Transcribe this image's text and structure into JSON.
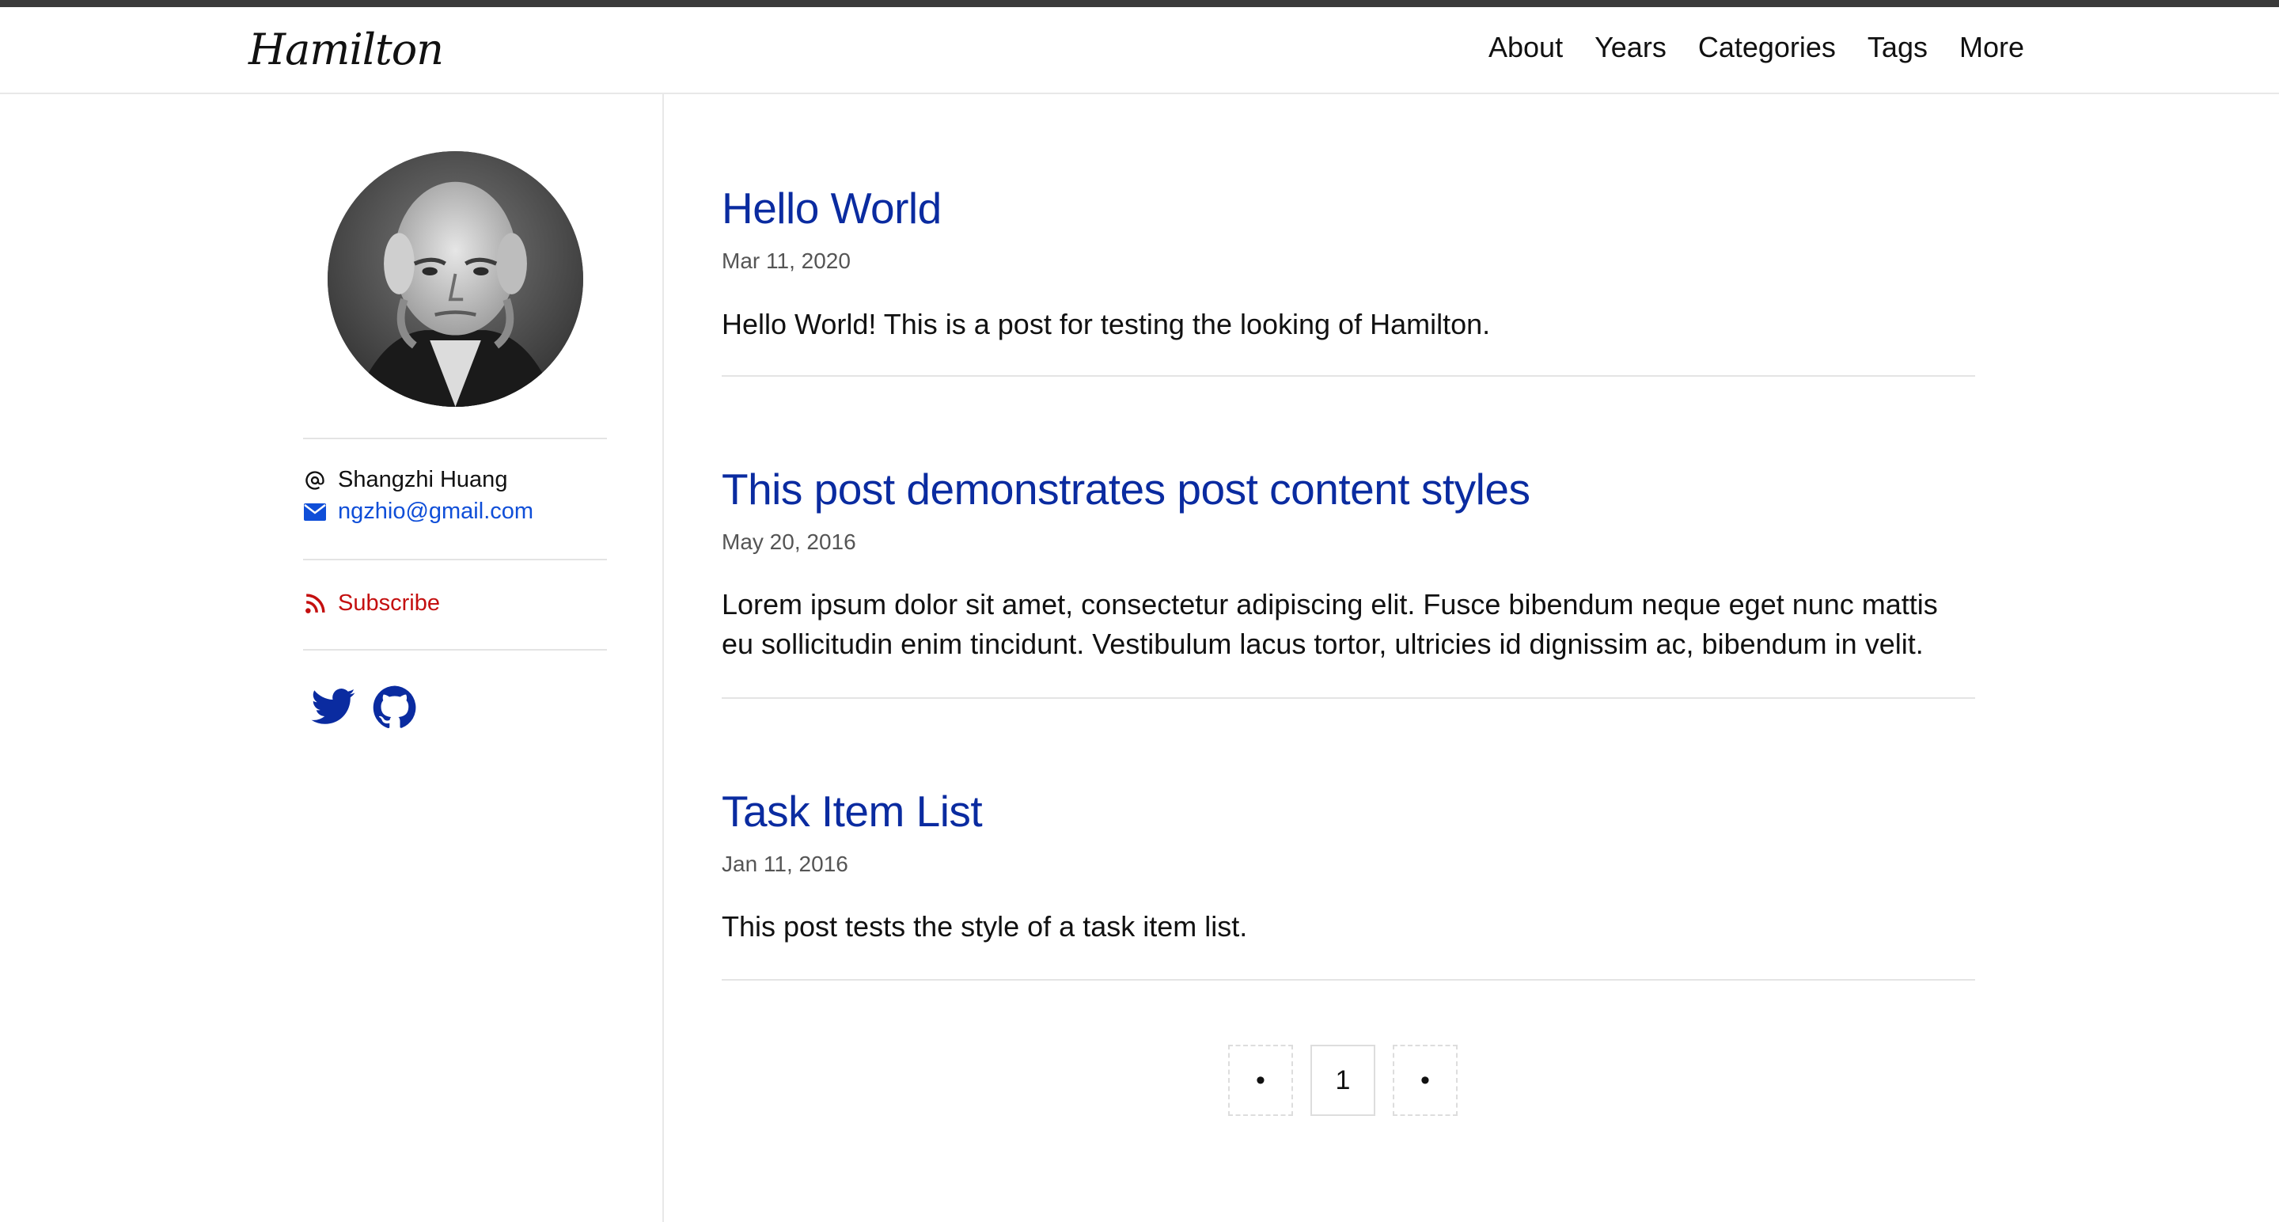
{
  "site": {
    "brand": "Hamilton"
  },
  "nav": {
    "items": [
      {
        "label": "About"
      },
      {
        "label": "Years"
      },
      {
        "label": "Categories"
      },
      {
        "label": "Tags"
      },
      {
        "label": "More"
      }
    ]
  },
  "sidebar": {
    "author_name": "Shangzhi Huang",
    "author_email": "ngzhio@gmail.com",
    "subscribe_label": "Subscribe",
    "social": [
      {
        "icon": "twitter-icon"
      },
      {
        "icon": "github-icon"
      }
    ]
  },
  "posts": [
    {
      "title": "Hello World",
      "date": "Mar 11, 2020",
      "excerpt": "Hello World! This is a post for testing the looking of Hamilton."
    },
    {
      "title": "This post demonstrates post content styles",
      "date": "May 20, 2016",
      "excerpt": "Lorem ipsum dolor sit amet, consectetur adipiscing elit. Fusce bibendum neque eget nunc mattis eu sollicitudin enim tincidunt. Vestibulum lacus tortor, ultricies id dignissim ac, bibendum in velit."
    },
    {
      "title": "Task Item List",
      "date": "Jan 11, 2016",
      "excerpt": "This post tests the style of a task item list."
    }
  ],
  "pagination": {
    "prev": "•",
    "current": "1",
    "next": "•"
  },
  "colors": {
    "link": "#0a2ba0",
    "email": "#0f4ed8",
    "subscribe": "#c40f0f",
    "stripe": "#3b3b3b"
  }
}
